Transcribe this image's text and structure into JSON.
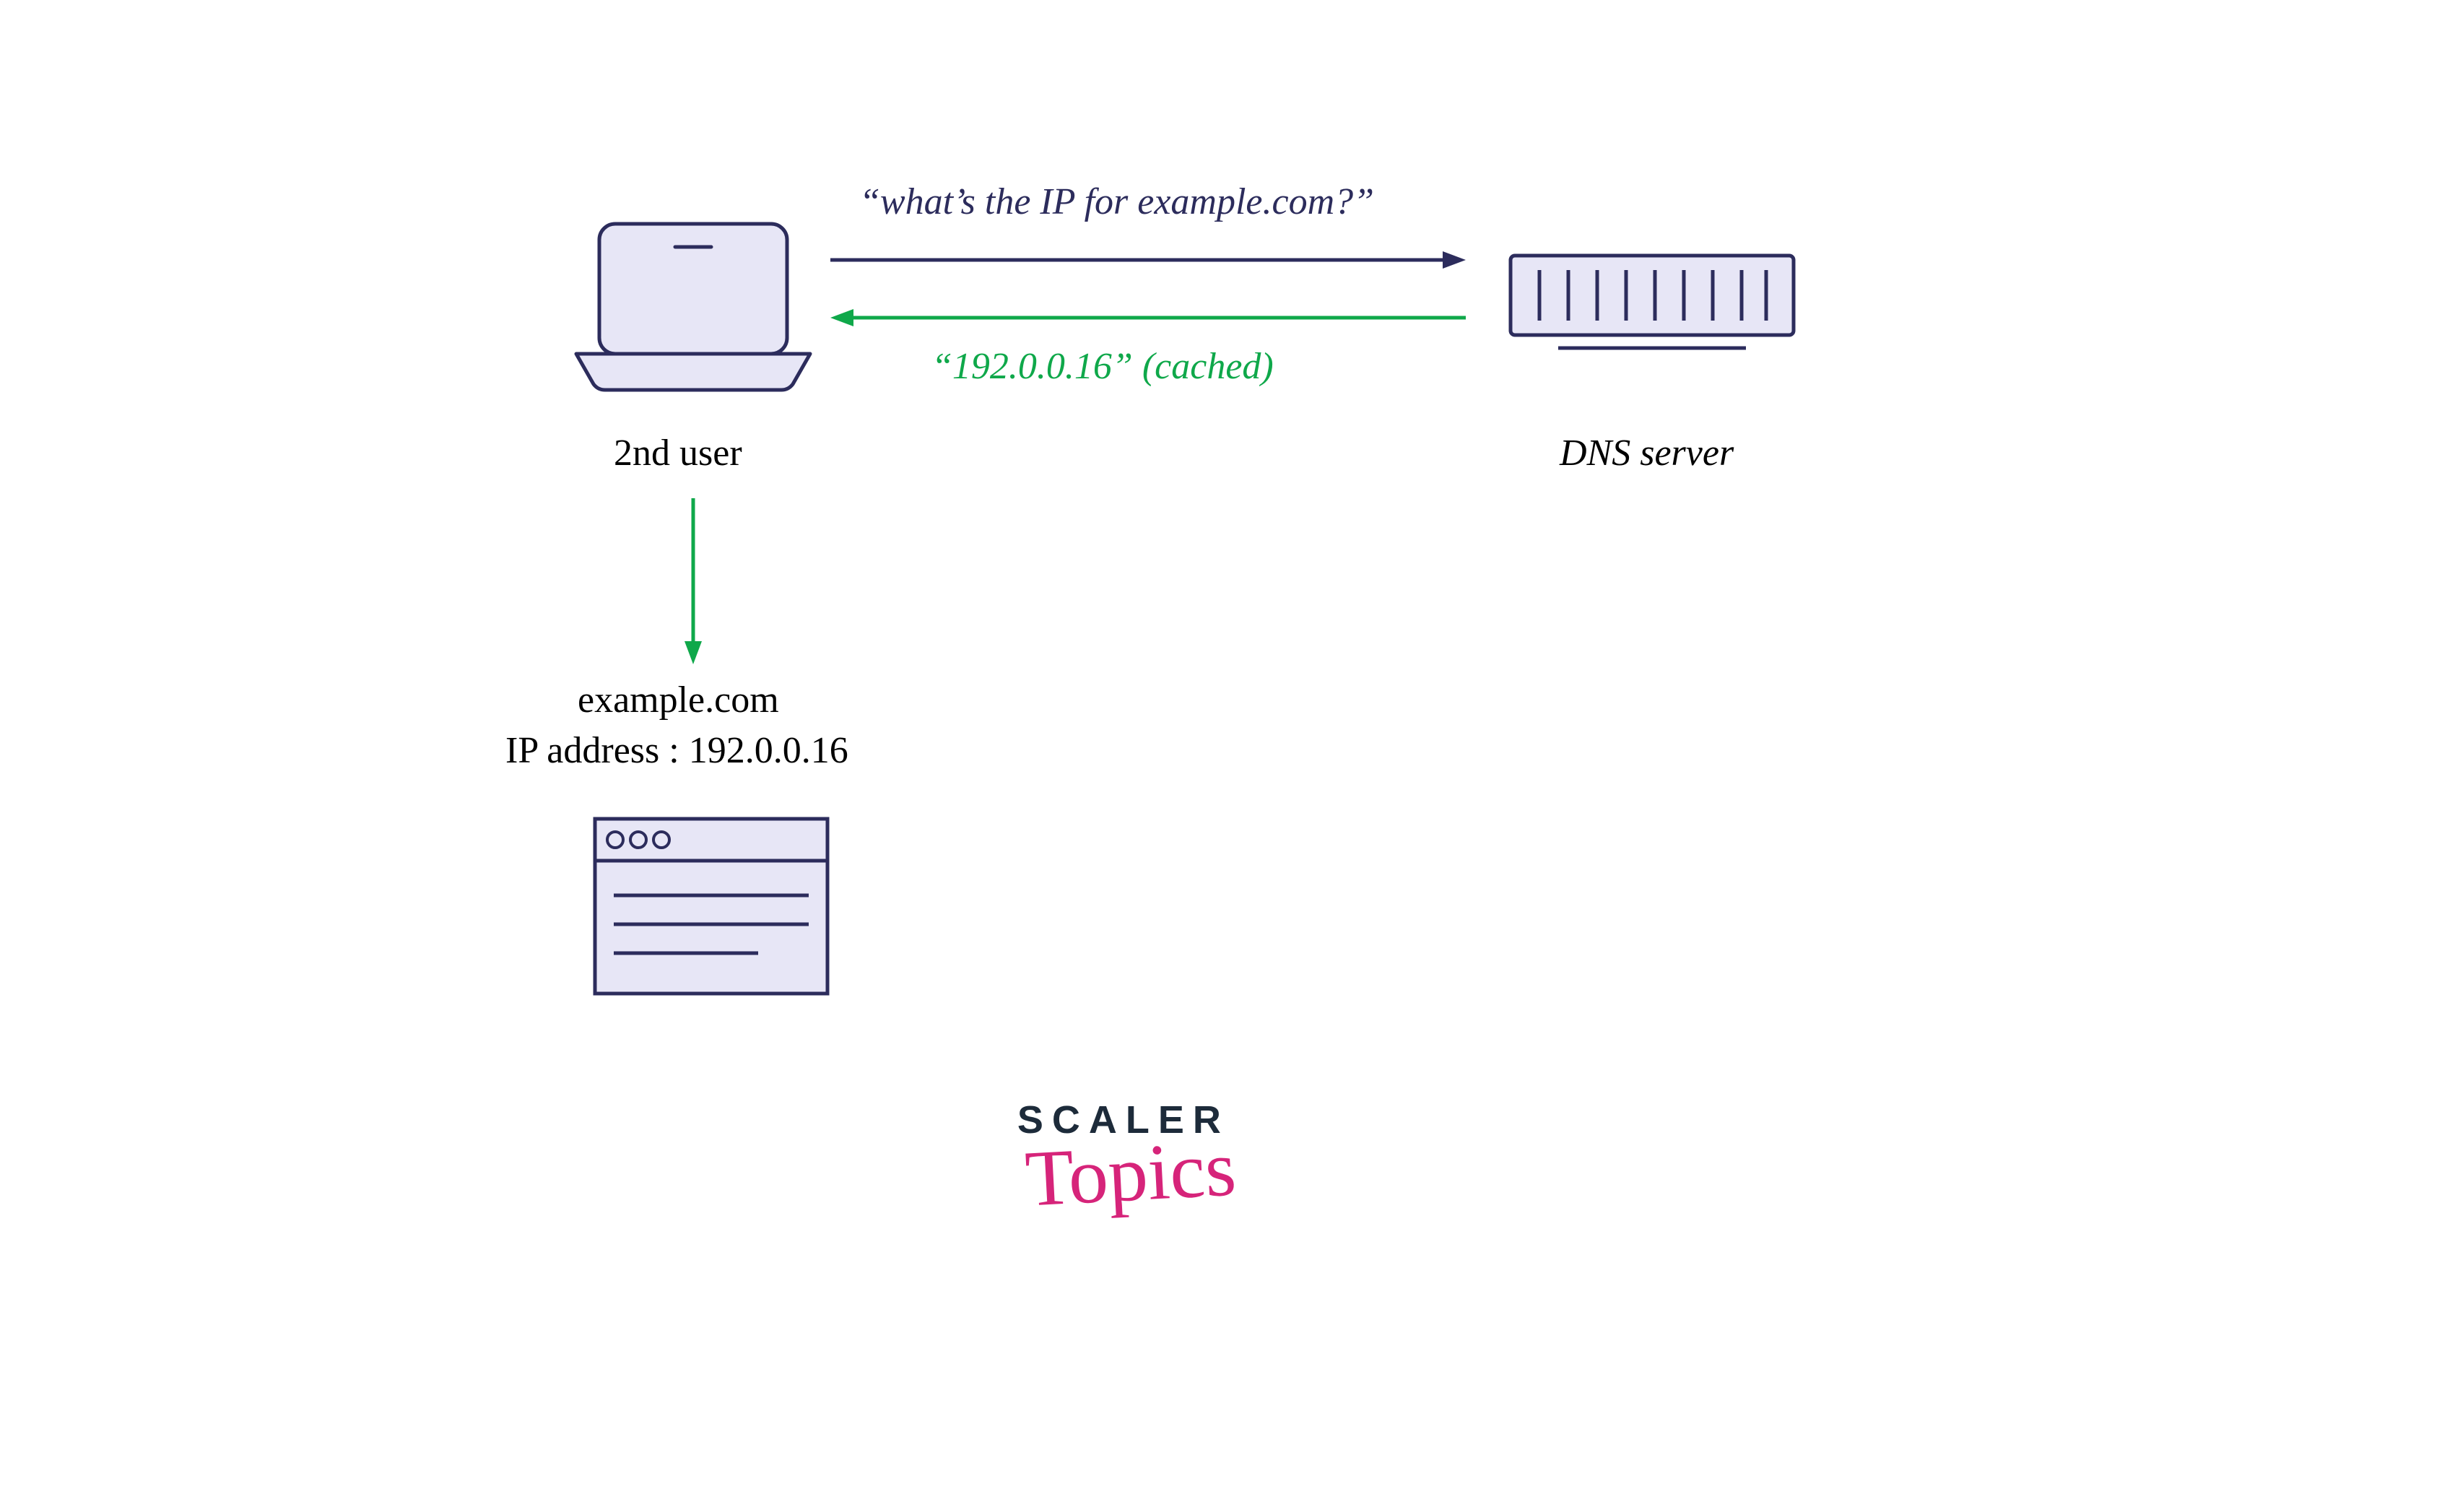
{
  "diagram": {
    "queryLabel": "“what’s the IP for example.com?”",
    "responseLabel": "“192.0.0.16” (cached)",
    "userLabel": "2nd user",
    "serverLabel": "DNS server",
    "exampleDomain": "example.com",
    "ipAddressLine": "IP address : 192.0.0.16"
  },
  "logo": {
    "line1": "SCALER",
    "line2": "Topics"
  },
  "colors": {
    "lavender": "#e7e6f6",
    "navy": "#2c2c5c",
    "green": "#0fa84a"
  }
}
